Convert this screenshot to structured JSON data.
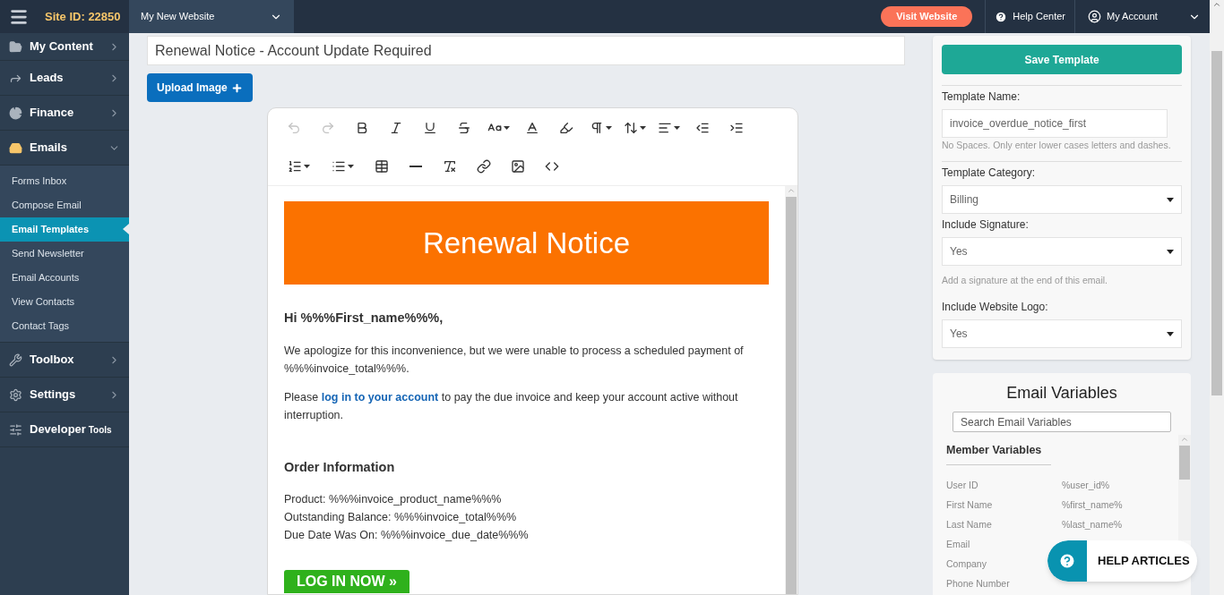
{
  "topbar": {
    "site_id": "Site ID: 22850",
    "website_select": "My New Website",
    "visit_button": "Visit Website",
    "help_center": "Help Center",
    "account": "My Account"
  },
  "sidebar": {
    "items": [
      {
        "kind": "folder",
        "label": "My Content",
        "expanded": false
      },
      {
        "kind": "share",
        "label": "Leads",
        "expanded": false
      },
      {
        "kind": "chart",
        "label": "Finance",
        "expanded": false
      },
      {
        "kind": "inbox",
        "label": "Emails",
        "expanded": true,
        "children": [
          {
            "label": "Forms Inbox",
            "selected": false
          },
          {
            "label": "Compose Email",
            "selected": false
          },
          {
            "label": "Email Templates",
            "selected": true
          },
          {
            "label": "Send Newsletter",
            "selected": false
          },
          {
            "label": "Email Accounts",
            "selected": false
          },
          {
            "label": "View Contacts",
            "selected": false
          },
          {
            "label": "Contact Tags",
            "selected": false
          }
        ]
      },
      {
        "kind": "wrench",
        "label": "Toolbox",
        "expanded": false
      },
      {
        "kind": "gear",
        "label": "Settings",
        "expanded": false
      },
      {
        "kind": "sliders",
        "label": "Developer",
        "label_small": "Tools"
      }
    ]
  },
  "subject": {
    "value": "Renewal Notice - Account Update Required"
  },
  "upload_button": "Upload Image",
  "toolbar": {
    "rows": [
      [
        {
          "kind": "undo",
          "disabled": true
        },
        {
          "kind": "redo",
          "disabled": true
        },
        {
          "kind": "bold",
          "disabled": false
        },
        {
          "kind": "italic",
          "disabled": false
        },
        {
          "kind": "underline",
          "disabled": false
        },
        {
          "kind": "strike",
          "disabled": false
        },
        {
          "kind": "fontsize",
          "disabled": false
        },
        {
          "kind": "color",
          "disabled": false
        },
        {
          "kind": "highlight",
          "disabled": false
        },
        {
          "kind": "paragraph",
          "disabled": false
        },
        {
          "kind": "lineheight",
          "disabled": false
        },
        {
          "kind": "align",
          "disabled": false
        },
        {
          "kind": "outdent",
          "disabled": false
        },
        {
          "kind": "indent",
          "disabled": false
        }
      ],
      [
        {
          "kind": "olist",
          "disabled": false
        },
        {
          "kind": "ulist",
          "disabled": false
        },
        {
          "kind": "table",
          "disabled": false
        },
        {
          "kind": "rule",
          "disabled": false
        },
        {
          "kind": "clearformat",
          "disabled": false
        },
        {
          "kind": "link",
          "disabled": false
        },
        {
          "kind": "image",
          "disabled": false
        },
        {
          "kind": "code",
          "disabled": false
        }
      ]
    ]
  },
  "email": {
    "banner": "Renewal Notice",
    "greeting": "Hi %%%First_name%%%,",
    "paragraph_1": "We apologize for this inconvenience, but we were unable to process a scheduled payment of %%%invoice_total%%%.",
    "paragraph_2": {
      "before": "Please ",
      "link": "log in to your account",
      "after": " to pay the due invoice and keep your account active without interruption."
    },
    "order_heading": "Order Information",
    "order_lines": [
      "Product: %%%invoice_product_name%%%",
      "Outstanding Balance: %%%invoice_total%%%",
      "Due Date Was On: %%%invoice_due_date%%%"
    ],
    "button": "LOG IN NOW »"
  },
  "settings": {
    "save_button": "Save Template",
    "name_label": "Template Name:",
    "name_value": "invoice_overdue_notice_first",
    "name_hint": "No Spaces. Only enter lower cases letters and dashes.",
    "category_label": "Template Category:",
    "category_value": "Billing",
    "signature_label": "Include Signature:",
    "signature_value": "Yes",
    "signature_hint": "Add a signature at the end of this email.",
    "logo_label": "Include Website Logo:",
    "logo_value": "Yes"
  },
  "variables": {
    "title": "Email Variables",
    "search_placeholder": "Search Email Variables",
    "section": "Member Variables",
    "rows": [
      {
        "label": "User ID",
        "value": "%user_id%"
      },
      {
        "label": "First Name",
        "value": "%first_name%"
      },
      {
        "label": "Last Name",
        "value": "%last_name%"
      },
      {
        "label": "Email"
      },
      {
        "label": "Company"
      },
      {
        "label": "Phone Number"
      }
    ]
  },
  "help_button": "HELP ARTICLES"
}
